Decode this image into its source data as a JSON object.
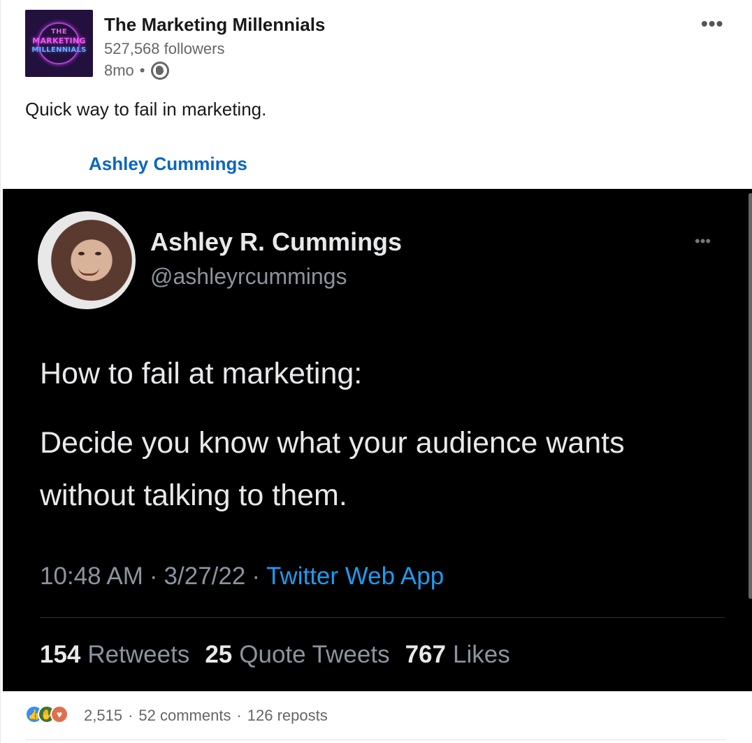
{
  "post": {
    "author": {
      "name": "The Marketing Millennials",
      "followers": "527,568 followers",
      "time": "8mo",
      "visibility_icon": "globe-icon",
      "logo_text": [
        "THE",
        "MARKETING",
        "MILLENNIALS"
      ]
    },
    "more_icon": "•••",
    "text": "Quick way to fail in marketing.",
    "mention": "Ashley Cummings"
  },
  "tweet": {
    "name": "Ashley R. Cummings",
    "handle": "@ashleyrcummings",
    "more_icon": "•••",
    "line1": "How to fail at marketing:",
    "line2": "Decide you know what your audience wants without talking to them.",
    "time": "10:48 AM",
    "date": "3/27/22",
    "app": "Twitter Web App",
    "retweets_count": "154",
    "retweets_label": "Retweets",
    "quotes_count": "25",
    "quotes_label": "Quote Tweets",
    "likes_count": "767",
    "likes_label": "Likes"
  },
  "social": {
    "reaction_icons": [
      "like-icon",
      "celebrate-icon",
      "love-icon"
    ],
    "reactions_count": "2,515",
    "comments": "52 comments",
    "reposts": "126 reposts"
  },
  "colors": {
    "link_blue": "#0a66c2",
    "twitter_blue": "#1d9bf0"
  }
}
